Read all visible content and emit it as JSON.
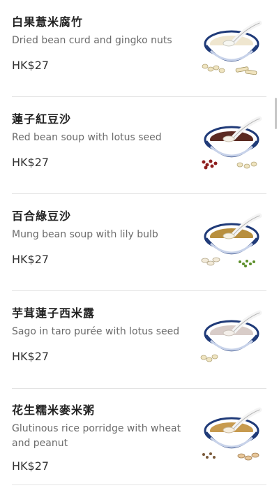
{
  "menu": {
    "items": [
      {
        "title": "白果薏米腐竹",
        "desc": "Dried bean curd and gingko nuts",
        "price": "HK$27",
        "soup": "#efe6cf",
        "icon": "dessert-bowl-icon"
      },
      {
        "title": "蓮子紅豆沙",
        "desc": "Red bean soup with lotus seed",
        "price": "HK$27",
        "soup": "#5b2a22",
        "icon": "dessert-bowl-icon"
      },
      {
        "title": "百合綠豆沙",
        "desc": "Mung bean soup with lily bulb",
        "price": "HK$27",
        "soup": "#b88f3e",
        "icon": "dessert-bowl-icon"
      },
      {
        "title": "芋茸蓮子西米露",
        "desc": "Sago in taro purée with lotus seed",
        "price": "HK$27",
        "soup": "#d8ccc8",
        "icon": "dessert-bowl-icon"
      },
      {
        "title": "花生糯米麥米粥",
        "desc": "Glutinous rice porridge with wheat and peanut",
        "price": "HK$27",
        "soup": "#c79a4e",
        "icon": "dessert-bowl-icon"
      }
    ]
  }
}
